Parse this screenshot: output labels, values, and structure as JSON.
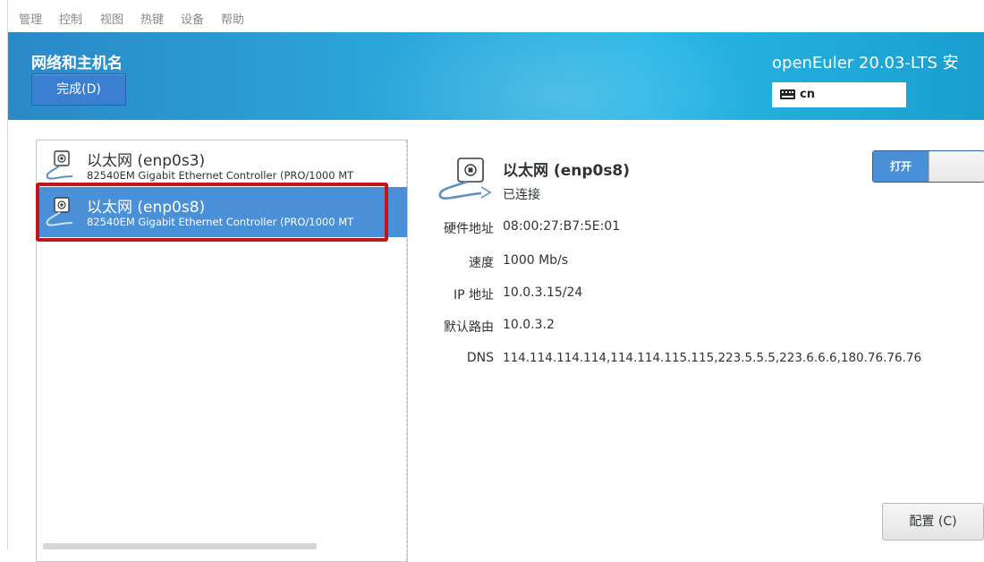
{
  "menubar": {
    "items": [
      "管理",
      "控制",
      "视图",
      "热键",
      "设备",
      "帮助"
    ]
  },
  "header": {
    "title": "网络和主机名",
    "done_label": "完成(D)",
    "product": "openEuler 20.03-LTS 安",
    "keyboard_layout": "cn"
  },
  "devices": [
    {
      "name": "以太网 (enp0s3)",
      "description": "82540EM Gigabit Ethernet Controller (PRO/1000 MT",
      "selected": false
    },
    {
      "name": "以太网 (enp0s8)",
      "description": "82540EM Gigabit Ethernet Controller (PRO/1000 MT",
      "selected": true
    }
  ],
  "details": {
    "name": "以太网 (enp0s8)",
    "status": "已连接",
    "toggle_label": "打开",
    "properties": [
      {
        "label": "硬件地址",
        "value": "08:00:27:B7:5E:01"
      },
      {
        "label": "速度",
        "value": "1000 Mb/s"
      },
      {
        "label": "IP 地址",
        "value": "10.0.3.15/24"
      },
      {
        "label": "默认路由",
        "value": "10.0.3.2"
      },
      {
        "label": "DNS",
        "value": "114.114.114.114,114.114.115.115,223.5.5.5,223.6.6.6,180.76.76.76"
      }
    ],
    "config_label": "配置 (C)"
  },
  "colors": {
    "header_blue": "#2ba3d8",
    "selected_row": "#4a90d9",
    "highlight_red": "#c0151b"
  }
}
